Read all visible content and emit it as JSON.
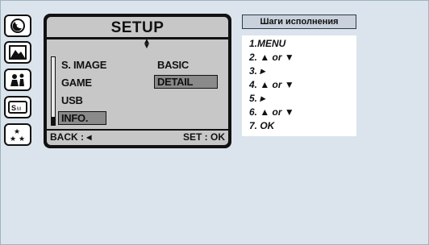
{
  "mode_icons": [
    {
      "name": "night-mode-icon"
    },
    {
      "name": "landscape-mode-icon"
    },
    {
      "name": "portrait-mode-icon"
    },
    {
      "name": "sport-mode-icon"
    },
    {
      "name": "fireworks-mode-icon"
    }
  ],
  "lcd": {
    "title": "SETUP",
    "updown_glyph": "▲▼",
    "menu_items": [
      "S. IMAGE",
      "GAME",
      "USB",
      "INFO."
    ],
    "selected_index": 3,
    "options": [
      "BASIC",
      "DETAIL"
    ],
    "selected_option": 1,
    "back_label": "BACK : ◂",
    "set_label": "SET : OK"
  },
  "steps_panel": {
    "header": "Шаги исполнения",
    "steps": [
      "1.MENU",
      "2. ▲ or ▼",
      "3. ▸",
      "4. ▲ or ▼",
      "5. ▸",
      "6. ▲ or ▼",
      "7. OK"
    ]
  },
  "colors": {
    "background": "#dbe4ec",
    "lcd_frame": "#111111",
    "lcd_screen": "#c7c7c7",
    "selection": "#8a8a8a"
  }
}
